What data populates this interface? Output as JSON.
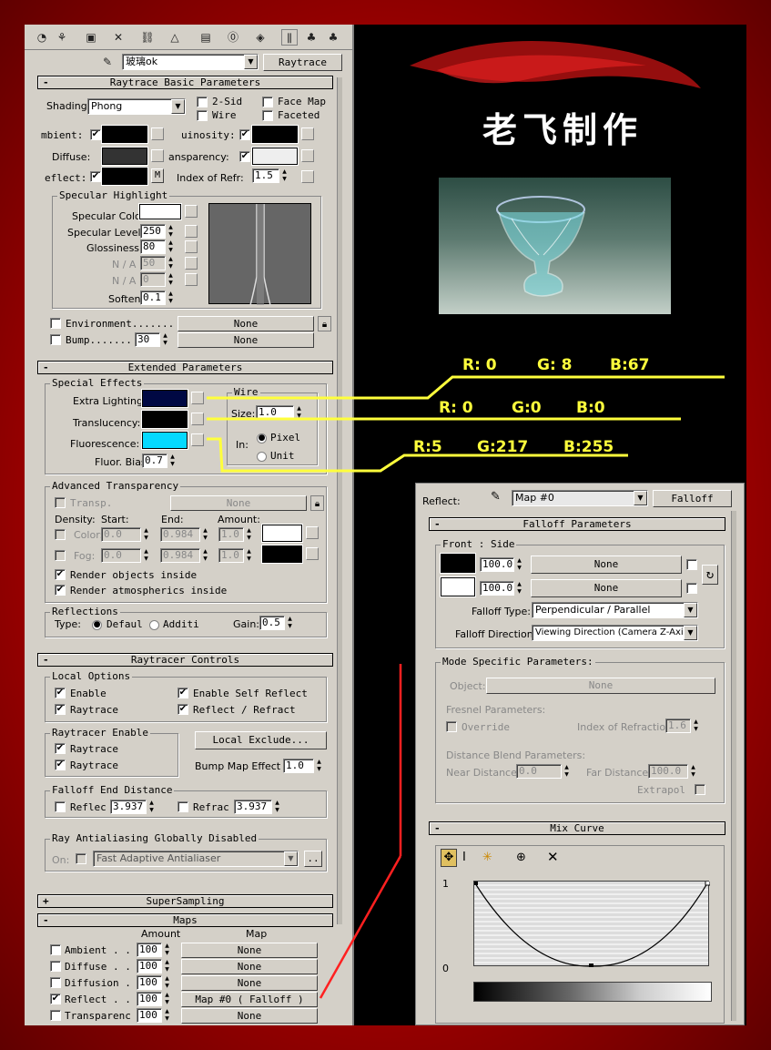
{
  "toolbar": {
    "icons": [
      "pin-stack-icon",
      "get-material-icon",
      "put-to-scene-icon",
      "delete-icon",
      "link-icon",
      "unique-icon",
      "put-library-icon",
      "material-id-icon",
      "show-map-icon",
      "show-end-icon",
      "go-parent-icon",
      "go-sibling-icon"
    ],
    "material_name": "玻璃ok",
    "material_type": "Raytrace"
  },
  "basic": {
    "title": "Raytrace Basic Parameters",
    "shading_label": "Shading:",
    "shading_value": "Phong",
    "two_sided": "2-Sid",
    "wire": "Wire",
    "face_map": "Face Map",
    "faceted": "Faceted",
    "ambient": "mbient:",
    "luminosity": "uinosity:",
    "diffuse": "Diffuse:",
    "transparency": "ansparency:",
    "reflect": "eflect:",
    "reflect_map": "M",
    "ior_label": "Index of Refr:",
    "ior_value": "1.5",
    "specular_title": "Specular Highlight",
    "spec_color": "Specular Color",
    "spec_level": "Specular Level:",
    "spec_level_value": "250",
    "glossiness": "Glossiness:",
    "glossiness_value": "80",
    "na1": "N / A",
    "na1_value": "50",
    "na2": "N / A",
    "na2_value": "0",
    "soften": "Soften",
    "soften_value": "0.1",
    "environment": "Environment.......",
    "environment_map": "None",
    "bump": "Bump.......",
    "bump_value": "30",
    "bump_map": "None"
  },
  "extended": {
    "title": "Extended Parameters",
    "special_title": "Special Effects",
    "extra_lighting": "Extra Lighting:",
    "translucency": "Translucency:",
    "fluorescence": "Fluorescence:",
    "fluor_bias": "Fluor. Bias:",
    "fluor_bias_value": "0.7",
    "wire_title": "Wire",
    "size_label": "Size:",
    "size_value": "1.0",
    "in_label": "In:",
    "pixels": "Pixel",
    "units": "Unit",
    "adv_title": "Advanced Transparency",
    "transp": "Transp.",
    "transp_map": "None",
    "density": "Density:",
    "start": "Start:",
    "end": "End:",
    "amount": "Amount:",
    "color": "Color:",
    "color_start": "0.0",
    "color_end": "0.984",
    "color_amount": "1.0",
    "fog": "Fog:",
    "fog_start": "0.0",
    "fog_end": "0.984",
    "fog_amount": "1.0",
    "render_objects": "Render objects inside",
    "render_atmos": "Render atmospherics inside",
    "reflections_title": "Reflections",
    "type_label": "Type:",
    "default": "Defaul",
    "additive": "Additi",
    "gain": "Gain:",
    "gain_value": "0.5"
  },
  "raytracer": {
    "title": "Raytracer Controls",
    "local_title": "Local Options",
    "enable": "Enable",
    "raytrace": "Raytrace",
    "self_reflect": "Enable Self Reflect",
    "reflect_refract": "Reflect / Refract",
    "enable_title": "Raytracer Enable",
    "rt1": "Raytrace",
    "rt2": "Raytrace",
    "local_exclude": "Local Exclude...",
    "bump_effect": "Bump Map Effect :",
    "bump_effect_value": "1.0",
    "falloff_title": "Falloff End Distance",
    "reflect": "Reflec",
    "reflect_value": "3.937",
    "refract": "Refrac",
    "refract_value": "3.937",
    "antialias_title": "Ray Antialiasing Globally Disabled",
    "on": "On:",
    "antialiaser": "Fast Adaptive Antialiaser",
    "more": ".."
  },
  "supersampling": "SuperSampling",
  "maps": {
    "title": "Maps",
    "amount_header": "Amount",
    "map_header": "Map",
    "rows": [
      {
        "label": "Ambient . .",
        "amount": "100",
        "map": "None",
        "checked": false
      },
      {
        "label": "Diffuse . .",
        "amount": "100",
        "map": "None",
        "checked": false
      },
      {
        "label": "Diffusion .",
        "amount": "100",
        "map": "None",
        "checked": false
      },
      {
        "label": "Reflect . .",
        "amount": "100",
        "map": "Map #0   ( Falloff )",
        "checked": true
      },
      {
        "label": "Transparenc",
        "amount": "100",
        "map": "None",
        "checked": false
      }
    ]
  },
  "viewport": {
    "title": "老飞制作",
    "rgb1": {
      "r": "R: 0",
      "g": "G: 8",
      "b": "B:67"
    },
    "rgb2": {
      "r": "R: 0",
      "g": "G:0",
      "b": "B:0"
    },
    "rgb3": {
      "r": "R:5",
      "g": "G:217",
      "b": "B:255"
    }
  },
  "falloff_panel": {
    "reflect_label": "Reflect:",
    "map_name": "Map #0",
    "map_type": "Falloff",
    "falloff_title": "Falloff Parameters",
    "front_side": "Front : Side",
    "front_value": "100.0",
    "front_map": "None",
    "side_value": "100.0",
    "side_map": "None",
    "falloff_type_label": "Falloff Type:",
    "falloff_type": "Perpendicular / Parallel",
    "falloff_dir_label": "Falloff Direction:",
    "falloff_dir": "Viewing Direction (Camera Z-Axis)",
    "mode_title": "Mode Specific Parameters:",
    "object": "Object:",
    "object_map": "None",
    "fresnel_title": "Fresnel Parameters:",
    "override": "Override",
    "ior_label": "Index of Refraction",
    "ior_value": "1.6",
    "distance_title": "Distance Blend Parameters:",
    "near": "Near Distance:",
    "near_value": "0.0",
    "far": "Far Distance:",
    "far_value": "100.0",
    "extrapolate": "Extrapol",
    "mix_title": "Mix Curve",
    "curve_top": "1",
    "curve_bottom": "0"
  },
  "colors": {
    "extra_lighting": "#000843",
    "translucency": "#000000",
    "fluorescence": "#05d9ff",
    "annotation": "#ffff3c",
    "connector": "#ff2020"
  }
}
